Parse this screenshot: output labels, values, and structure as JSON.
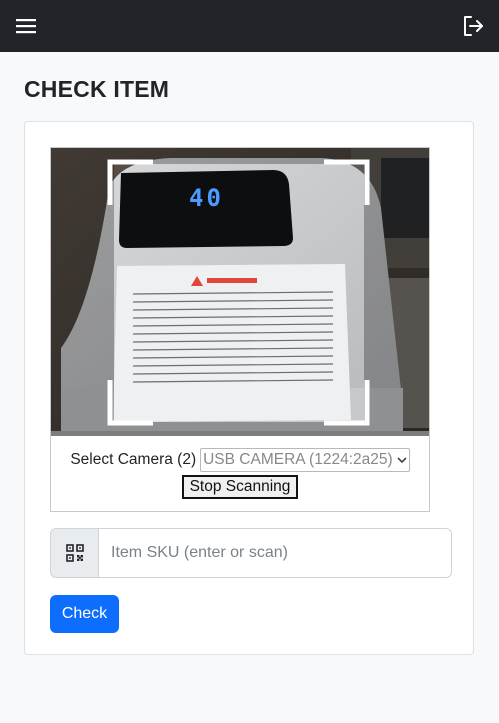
{
  "navbar": {
    "menu_icon": "hamburger-menu-icon",
    "logout_icon": "logout-icon",
    "background": "#212529"
  },
  "page": {
    "title": "CHECK ITEM"
  },
  "scanner": {
    "camera_label": "Select Camera (2)",
    "camera_selected": "USB CAMERA (1224:2a25)",
    "stop_label": "Stop Scanning",
    "device_display": "40"
  },
  "sku": {
    "icon": "qr-code-icon",
    "placeholder": "Item SKU (enter or scan)",
    "value": ""
  },
  "actions": {
    "check_label": "Check"
  },
  "colors": {
    "primary": "#0d6efd",
    "page_bg": "#f8f9fa"
  }
}
